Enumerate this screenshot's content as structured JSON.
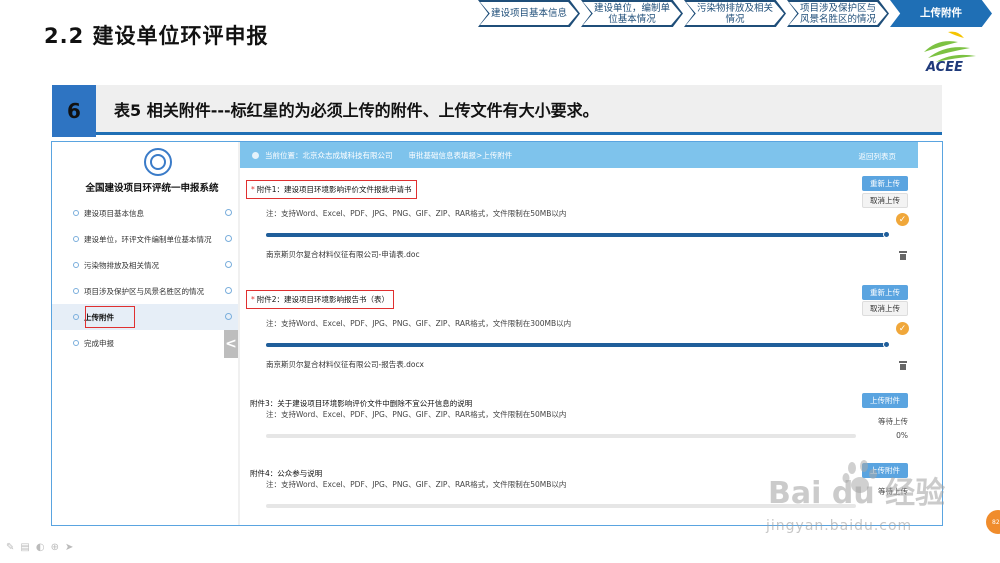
{
  "slide": {
    "title": "2.2  建设单位环评申报",
    "section_number": "6",
    "section_text": "表5 相关附件---标红星的为必须上传的附件、上传文件有大小要求。"
  },
  "steps": [
    {
      "label": "建设项目基本信息",
      "active": false
    },
    {
      "label": "建设单位，编制单位基本情况",
      "active": false
    },
    {
      "label": "污染物排放及相关情况",
      "active": false
    },
    {
      "label": "项目涉及保护区与风景名胜区的情况",
      "active": false
    },
    {
      "label": "上传附件",
      "active": true
    }
  ],
  "logo": {
    "text": "ACEE",
    "colors": [
      "#7cc242",
      "#f5c400",
      "#1f3a7a"
    ]
  },
  "app": {
    "system_title": "全国建设项目环评统一申报系统",
    "nav": [
      {
        "label": "建设项目基本信息",
        "active": false
      },
      {
        "label": "建设单位，环评文件编制单位基本情况",
        "active": false
      },
      {
        "label": "污染物排放及相关情况",
        "active": false
      },
      {
        "label": "项目涉及保护区与风景名胜区的情况",
        "active": false
      },
      {
        "label": "上传附件",
        "active": true
      },
      {
        "label": "完成申报",
        "active": false
      }
    ],
    "collapse_glyph": "<",
    "breadcrumb": {
      "prefix": "当前位置：北京众志成城科技有限公司",
      "path": "审批基础信息表填报>上传附件",
      "back": "返回列表页"
    },
    "attachments": [
      {
        "title": "附件1：建设项目环境影响评价文件报批申请书",
        "required": true,
        "note": "注：支持Word、Excel、PDF、JPG、PNG、GIF、ZIP、RAR格式，文件限制在50MB以内",
        "primary_button": "重新上传",
        "secondary_button": "取消上传",
        "progress": 1.0,
        "file": "南京斯贝尔复合材料仪征有限公司-申请表.doc"
      },
      {
        "title": "附件2：建设项目环境影响报告书（表）",
        "required": true,
        "note": "注：支持Word、Excel、PDF、JPG、PNG、GIF、ZIP、RAR格式，文件限制在300MB以内",
        "primary_button": "重新上传",
        "secondary_button": "取消上传",
        "progress": 1.0,
        "file": "南京斯贝尔复合材料仪征有限公司-报告表.docx"
      },
      {
        "title": "附件3：关于建设项目环境影响评价文件中删除不宜公开信息的说明",
        "required": false,
        "note": "注：支持Word、Excel、PDF、JPG、PNG、GIF、ZIP、RAR格式，文件限制在50MB以内",
        "primary_button": "上传附件",
        "status": "等待上传",
        "progress": 0.0,
        "progress_label": "0%"
      },
      {
        "title": "附件4：公众参与说明",
        "required": false,
        "note": "注：支持Word、Excel、PDF、JPG、PNG、GIF、ZIP、RAR格式，文件限制在50MB以内",
        "primary_button": "上传附件",
        "status": "等待上传",
        "progress": 0.0
      }
    ]
  },
  "watermark": {
    "main": "Bai du 经验",
    "sub": "jingyan.baidu.com"
  },
  "page_badge": "82"
}
